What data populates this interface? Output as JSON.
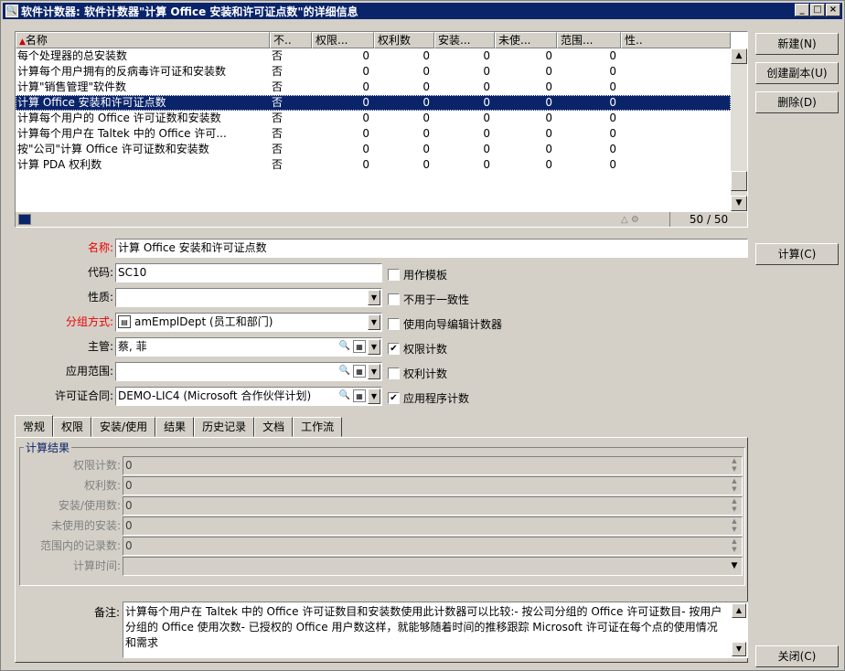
{
  "window": {
    "title": "软件计数器: 软件计数器\"计算 Office 安装和许可证点数\"的详细信息",
    "controls": [
      "_",
      "□",
      "×"
    ]
  },
  "list": {
    "columns": [
      "名称",
      "不..",
      "权限...",
      "权利数",
      "安装...",
      "未使...",
      "范围...",
      "性.."
    ],
    "rows": [
      [
        "每个处理器的总安装数",
        "否",
        "0",
        "0",
        "0",
        "0",
        "0",
        ""
      ],
      [
        "计算每个用户拥有的反病毒许可证和安装数",
        "否",
        "0",
        "0",
        "0",
        "0",
        "0",
        ""
      ],
      [
        "计算\"销售管理\"软件数",
        "否",
        "0",
        "0",
        "0",
        "0",
        "0",
        ""
      ],
      [
        "计算 Office 安装和许可证点数",
        "否",
        "0",
        "0",
        "0",
        "0",
        "0",
        ""
      ],
      [
        "计算每个用户的 Office 许可证数和安装数",
        "否",
        "0",
        "0",
        "0",
        "0",
        "0",
        ""
      ],
      [
        "计算每个用户在 Taltek 中的 Office 许可...",
        "否",
        "0",
        "0",
        "0",
        "0",
        "0",
        ""
      ],
      [
        "按\"公司\"计算 Office 许可证数和安装数",
        "否",
        "0",
        "0",
        "0",
        "0",
        "0",
        ""
      ],
      [
        "计算 PDA 权利数",
        "否",
        "0",
        "0",
        "0",
        "0",
        "0",
        ""
      ]
    ],
    "selected_index": 3,
    "count": "50 / 50"
  },
  "buttons": {
    "new": "新建(N)",
    "copy": "创建副本(U)",
    "delete": "删除(D)",
    "compute": "计算(C)",
    "close": "关闭(C)"
  },
  "form": {
    "name_label": "名称:",
    "name_value": "计算 Office 安装和许可证点数",
    "code_label": "代码:",
    "code_value": "SC10",
    "nature_label": "性质:",
    "nature_value": "",
    "group_label": "分组方式:",
    "group_value": "amEmplDept (员工和部门)",
    "manager_label": "主管:",
    "manager_value": "蔡, 菲",
    "scope_label": "应用范围:",
    "scope_value": "",
    "contract_label": "许可证合同:",
    "contract_value": "DEMO-LIC4 (Microsoft 合作伙伴计划)",
    "checks": [
      {
        "label": "用作模板",
        "checked": false
      },
      {
        "label": "不用于一致性",
        "checked": false
      },
      {
        "label": "使用向导编辑计数器",
        "checked": false
      },
      {
        "label": "权限计数",
        "checked": true
      },
      {
        "label": "权利计数",
        "checked": false
      },
      {
        "label": "应用程序计数",
        "checked": true
      }
    ]
  },
  "tabs": [
    "常规",
    "权限",
    "安装/使用",
    "结果",
    "历史记录",
    "文档",
    "工作流"
  ],
  "active_tab": 0,
  "results": {
    "group_title": "计算结果",
    "rows": [
      {
        "label": "权限计数:",
        "value": "0"
      },
      {
        "label": "权利数:",
        "value": "0"
      },
      {
        "label": "安装/使用数:",
        "value": "0"
      },
      {
        "label": "未使用的安装:",
        "value": "0"
      },
      {
        "label": "范围内的记录数:",
        "value": "0"
      },
      {
        "label": "计算时间:",
        "value": ""
      }
    ],
    "memo_label": "备注:",
    "memo_text": "计算每个用户在 Taltek 中的 Office 许可证数目和安装数使用此计数器可以比较:- 按公司分组的 Office 许可证数目- 按用户分组的 Office 使用次数- 已授权的 Office 用户数这样，就能够随着时间的推移跟踪 Microsoft 许可证在每个点的使用情况和需求"
  },
  "colors": {
    "titlebar": "#0a246a",
    "selection": "#0a246a",
    "required_label": "#e00000",
    "face": "#d4d0c8"
  }
}
